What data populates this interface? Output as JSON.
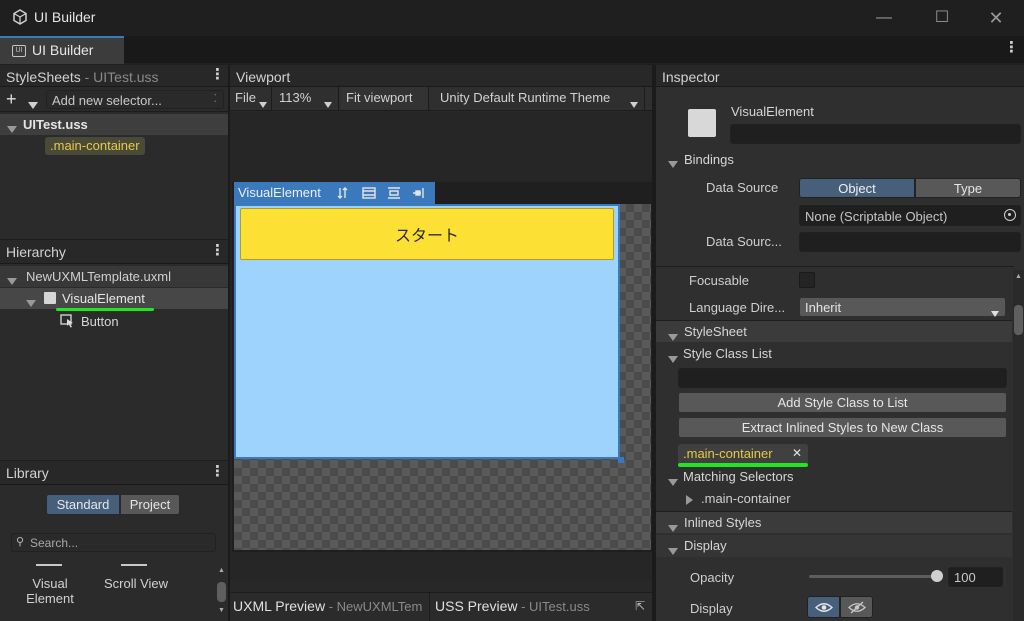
{
  "window": {
    "title": "UI Builder",
    "controls": [
      "minimize-icon",
      "maximize-icon",
      "close-icon"
    ]
  },
  "tab": {
    "label": "UI Builder",
    "icon_text": "UI"
  },
  "stylesheets": {
    "header": "StyleSheets",
    "header_file": "- UITest.uss",
    "add_selector_placeholder": "Add new selector...",
    "file_name": "UITest.uss",
    "selector": ".main-container"
  },
  "hierarchy": {
    "header": "Hierarchy",
    "root": "NewUXMLTemplate.uxml",
    "items": [
      {
        "label": "VisualElement"
      },
      {
        "label": "Button"
      }
    ]
  },
  "library": {
    "header": "Library",
    "tabs": [
      "Standard",
      "Project"
    ],
    "search_placeholder": "Search...",
    "items": [
      "Visual\nElement",
      "Scroll View"
    ]
  },
  "viewport": {
    "header": "Viewport",
    "toolbar": {
      "file": "File",
      "zoom": "113%",
      "fit": "Fit viewport",
      "theme": "Unity Default Runtime Theme"
    },
    "element_label": "VisualElement",
    "button_text": "スタート",
    "colors": {
      "container": "#9ed3fd",
      "button": "#fde034",
      "selection": "#3a79bb"
    }
  },
  "bottom_tabs": {
    "uxml_preview": "UXML Preview",
    "uxml_file": "- NewUXMLTem",
    "uss_preview": "USS Preview",
    "uss_file": "- UITest.uss"
  },
  "inspector": {
    "header": "Inspector",
    "element_type": "VisualElement",
    "element_name_value": "",
    "bindings": {
      "title": "Bindings",
      "data_source_label": "Data Source",
      "toggle": [
        "Object",
        "Type"
      ],
      "object_field": "None (Scriptable Object)",
      "data_source_path_label": "Data Sourc..."
    },
    "focusable_label": "Focusable",
    "language_direction_label": "Language Dire...",
    "language_direction_value": "Inherit",
    "stylesheet_title": "StyleSheet",
    "style_class_list_title": "Style Class List",
    "add_class_button": "Add Style Class to List",
    "extract_button": "Extract Inlined Styles to New Class",
    "class_pill": ".main-container",
    "matching_selectors_title": "Matching Selectors",
    "matching_selector_item": ".main-container",
    "inlined_styles_title": "Inlined Styles",
    "display_title": "Display",
    "opacity_label": "Opacity",
    "opacity_value": "100",
    "opacity_fraction": 1.0,
    "display_label": "Display"
  }
}
